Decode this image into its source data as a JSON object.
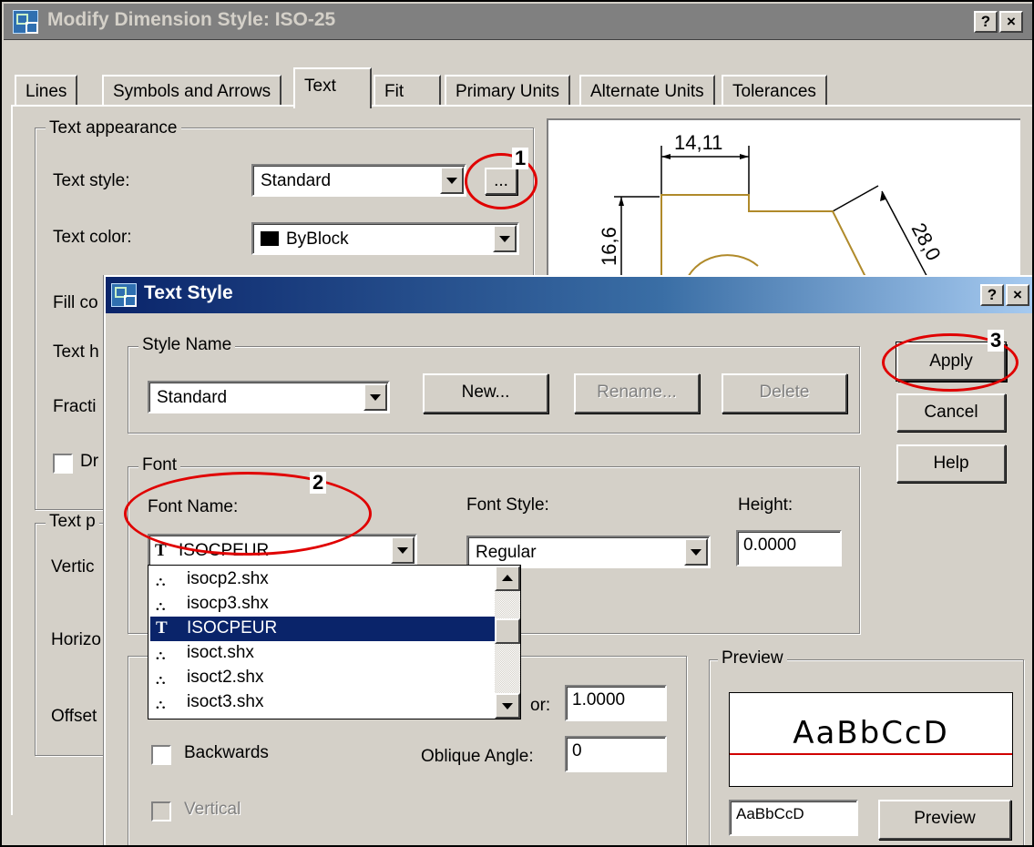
{
  "main_window": {
    "title": "Modify Dimension Style: ISO-25",
    "help_btn": "?",
    "close_btn": "×",
    "tabs": [
      {
        "label": "Lines"
      },
      {
        "label": "Symbols and Arrows"
      },
      {
        "label": "Text"
      },
      {
        "label": "Fit"
      },
      {
        "label": "Primary Units"
      },
      {
        "label": "Alternate Units"
      },
      {
        "label": "Tolerances"
      }
    ],
    "text_appearance": {
      "legend": "Text appearance",
      "text_style_label": "Text style:",
      "text_style_value": "Standard",
      "browse_btn": "...",
      "text_color_label": "Text color:",
      "text_color_value": "ByBlock",
      "fill_color_label": "Fill co",
      "text_height_label": "Text h",
      "fraction_label": "Fracti",
      "draw_frame_label": "Dr"
    },
    "text_placement": {
      "legend": "Text p",
      "vertical_label": "Vertic",
      "horizontal_label": "Horizo",
      "offset_label": "Offset"
    },
    "preview_dims": {
      "top": "14,11",
      "left": "16,6",
      "right": "28,0"
    }
  },
  "text_style_dialog": {
    "title": "Text Style",
    "help_btn": "?",
    "close_btn": "×",
    "style_name": {
      "legend": "Style Name",
      "value": "Standard",
      "new_btn": "New...",
      "rename_btn": "Rename...",
      "delete_btn": "Delete"
    },
    "buttons": {
      "apply": "Apply",
      "cancel": "Cancel",
      "help": "Help"
    },
    "font": {
      "legend": "Font",
      "font_name_label": "Font Name:",
      "font_name_value": "ISOCPEUR",
      "font_style_label": "Font Style:",
      "font_style_value": "Regular",
      "height_label": "Height:",
      "height_value": "0.0000",
      "list": [
        {
          "label": "isocp2.shx",
          "kind": "shx",
          "selected": false
        },
        {
          "label": "isocp3.shx",
          "kind": "shx",
          "selected": false
        },
        {
          "label": "ISOCPEUR",
          "kind": "tt",
          "selected": true
        },
        {
          "label": "isoct.shx",
          "kind": "shx",
          "selected": false
        },
        {
          "label": "isoct2.shx",
          "kind": "shx",
          "selected": false
        },
        {
          "label": "isoct3.shx",
          "kind": "shx",
          "selected": false
        }
      ]
    },
    "effects": {
      "width_factor_label": "or:",
      "width_factor_value": "1.0000",
      "oblique_label": "Oblique Angle:",
      "oblique_value": "0",
      "backwards_label": "Backwards",
      "vertical_label": "Vertical"
    },
    "preview": {
      "legend": "Preview",
      "sample": "AaBbCcD",
      "input_value": "AaBbCcD",
      "preview_btn": "Preview"
    }
  },
  "annotations": [
    "1",
    "2",
    "3"
  ],
  "colors": {
    "annotation": "#e00000",
    "selection": "#0a246a",
    "geometry": "#b08a2a",
    "baseline": "#d00000"
  },
  "icons": {
    "app": "autocad-dialog-icon",
    "shx_font": "shx-font-icon",
    "truetype_font": "truetype-font-icon"
  }
}
